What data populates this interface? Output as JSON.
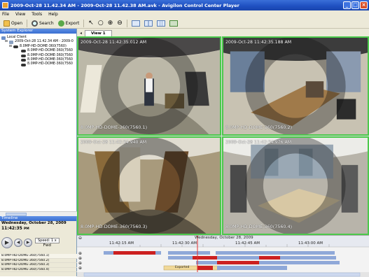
{
  "window": {
    "title": "2009-Oct-28 11.42.34 AM - 2009-Oct-28 11.42.38 AM.avk - Avigilon Control Center Player",
    "controls": [
      "_",
      "□",
      "×"
    ]
  },
  "menu": [
    "File",
    "View",
    "Tools",
    "Help"
  ],
  "toolbar": {
    "open_label": "Open",
    "search_label": "Search",
    "export_label": "Export",
    "icons": [
      "folder-open-icon",
      "search-icon",
      "export-icon",
      "pointer-icon",
      "rotate-icon",
      "zoom-in-icon",
      "zoom-out-icon",
      "layout-1-icon",
      "layout-4-icon",
      "layout-9-icon",
      "fullscreen-icon"
    ]
  },
  "system_explorer": {
    "title": "System Explorer",
    "root": "Local Client",
    "site": "2009-Oct-28 11.42.34 AM - 2009-0",
    "cameras": [
      "8.0MP-HD-DOME-360(7560)",
      "8.0MP-HD-DOME-360(7560",
      "8.0MP-HD-DOME-360(7560",
      "8.0MP-HD-DOME-360(7560",
      "8.0MP-HD-DOME-360(7560"
    ]
  },
  "view": {
    "tab_label": "View 1",
    "cameras": [
      {
        "timestamp": "2009-Oct-28 11:42:35.012 AM",
        "name": "8.0MP-HD-DOME-360(7560.1)"
      },
      {
        "timestamp": "2009-Oct-28 11:42:35.188 AM",
        "name": "8.0MP-HD-DOME-360(7560.2)"
      },
      {
        "timestamp": "2009-Oct-28 11:42:34.940 AM",
        "name": "8.0MP-HD-DOME-360(7560.3)"
      },
      {
        "timestamp": "2009-Oct-28 11:42:34.976 AM",
        "name": "8.0MP-HD-DOME-360(7560.4)"
      }
    ],
    "border_color": "#4cc94c"
  },
  "timeline": {
    "title": "Timeline",
    "date": "Wednesday, October 28, 2009",
    "time": "11:42:35",
    "time_suffix": "PM",
    "speed_label": "Speed: 1 x",
    "speed_sub": "Fwd",
    "header_date": "Wednesday, October 28, 2009",
    "ticks": [
      "11:42:15 AM",
      "11:42:30 AM",
      "11:42:45 AM",
      "11:43:00 AM"
    ],
    "channels": [
      "8.0MP-HD-DOME-360(7560.1)",
      "8.0MP-HD-DOME-360(7560.2)",
      "8.0MP-HD-DOME-360(7560.3)",
      "8.0MP-HD-DOME-360(7560.4)"
    ],
    "bookmark_label": "Exported",
    "colors": {
      "recording": "#8fa8d8",
      "motion": "#cc2020",
      "bookmark": "#f0d898",
      "cursor": "#e03030"
    }
  }
}
